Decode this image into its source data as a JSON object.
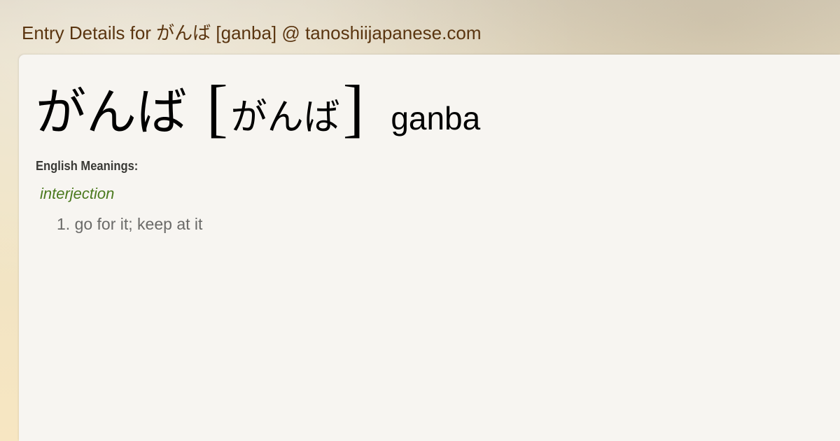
{
  "page": {
    "title": "Entry Details for がんば [ganba] @ tanoshiijapanese.com"
  },
  "entry": {
    "kanji": "がんば",
    "bracket_open": "[",
    "reading": "がんば",
    "bracket_close": "]",
    "romaji": "ganba"
  },
  "meanings": {
    "label": "English Meanings:",
    "part_of_speech": "interjection",
    "senses": [
      {
        "text": "1. go for it; keep at it"
      }
    ]
  },
  "colors": {
    "title": "#5a3510",
    "part_of_speech": "#4b7a1e",
    "sense_text": "#6a6a68",
    "panel": "#f7f5f1"
  }
}
